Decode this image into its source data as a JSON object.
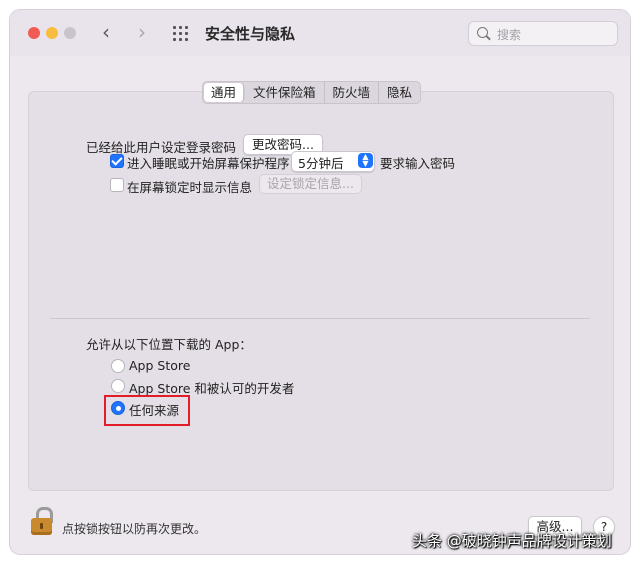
{
  "window": {
    "title": "安全性与隐私"
  },
  "toolbar": {
    "back_icon": "chevron-left-icon",
    "forward_icon": "chevron-right-icon",
    "grid_icon": "grid-icon",
    "search_placeholder": "搜索"
  },
  "tabs": [
    {
      "label": "通用",
      "active": true
    },
    {
      "label": "文件保险箱",
      "active": false
    },
    {
      "label": "防火墙",
      "active": false
    },
    {
      "label": "隐私",
      "active": false
    }
  ],
  "general": {
    "password_label": "已经给此用户设定登录密码",
    "change_password_button": "更改密码...",
    "require_password": {
      "checked": true,
      "label": "进入睡眠或开始屏幕保护程序",
      "select_value": "5分钟后",
      "after_label": "要求输入密码"
    },
    "show_message": {
      "checked": false,
      "label": "在屏幕锁定时显示信息",
      "button": "设定锁定信息..."
    }
  },
  "downloads": {
    "label": "允许从以下位置下载的 App：",
    "options": [
      {
        "label": "App Store",
        "selected": false
      },
      {
        "label": "App Store 和被认可的开发者",
        "selected": false
      },
      {
        "label": "任何来源",
        "selected": true
      }
    ],
    "highlight_color": "#e11e27"
  },
  "footer": {
    "lock_text": "点按锁按钮以防再次更改。",
    "advanced_button": "高级...",
    "help_button": "?"
  },
  "watermark": "头条 @破晓钟声品牌设计策划",
  "colors": {
    "accent": "#1f74ff",
    "close": "#f25b54",
    "minimize": "#f7bd3e"
  }
}
